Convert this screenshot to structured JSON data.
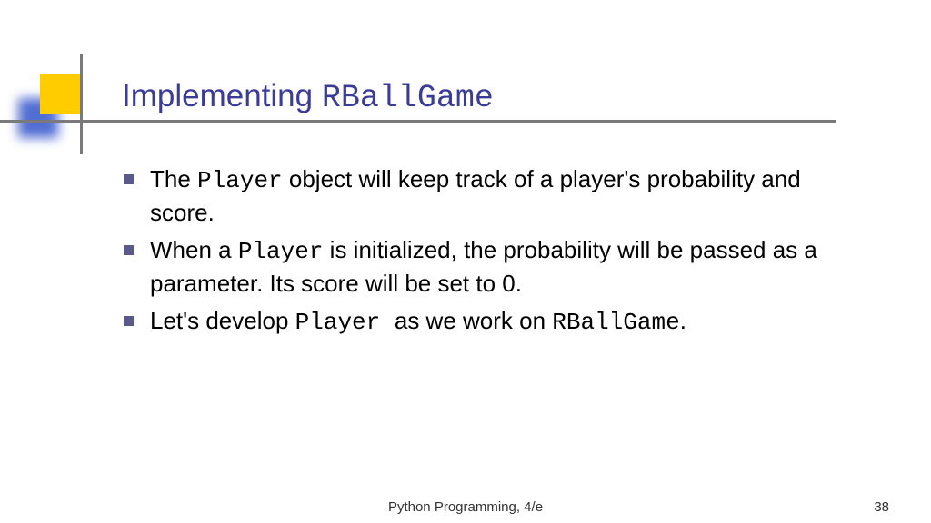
{
  "title": {
    "plain": "Implementing ",
    "mono": "RBallGame"
  },
  "bullets": [
    {
      "segments": [
        {
          "t": "The ",
          "mono": false
        },
        {
          "t": "Player",
          "mono": true
        },
        {
          "t": " object will keep track of a player's probability and score.",
          "mono": false
        }
      ]
    },
    {
      "segments": [
        {
          "t": "When a ",
          "mono": false
        },
        {
          "t": "Player",
          "mono": true
        },
        {
          "t": " is initialized, the probability will be passed as a parameter. Its score will be set to 0.",
          "mono": false
        }
      ]
    },
    {
      "segments": [
        {
          "t": "Let's develop ",
          "mono": false
        },
        {
          "t": "Player ",
          "mono": true
        },
        {
          "t": " as we work on ",
          "mono": false
        },
        {
          "t": "RBallGame",
          "mono": true
        },
        {
          "t": ".",
          "mono": false
        }
      ]
    }
  ],
  "footer": {
    "center": "Python Programming, 4/e",
    "page": "38"
  }
}
